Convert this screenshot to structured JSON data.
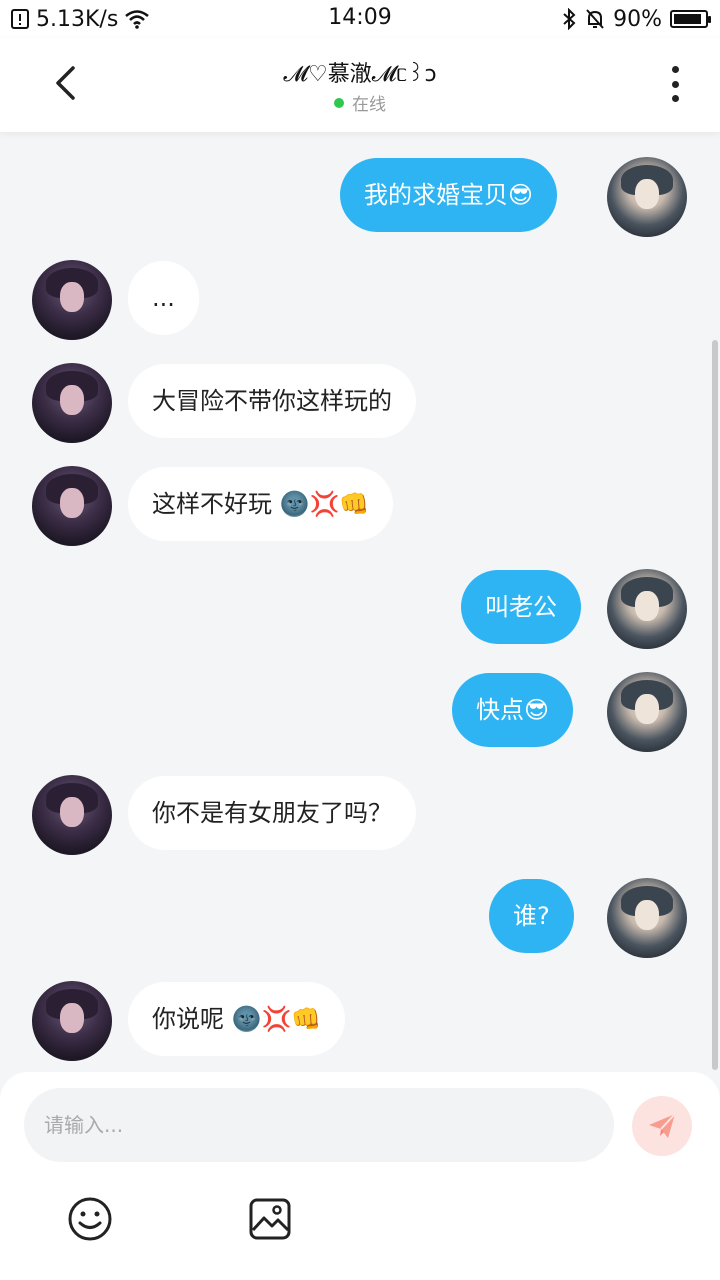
{
  "status_bar": {
    "speed": "5.13K/s",
    "time": "14:09",
    "battery": "90%",
    "battery_level": 0.9
  },
  "header": {
    "title": "𝓜♡慕澈𝓜ᥴ꒱ↄ",
    "status": "在线"
  },
  "messages": [
    {
      "side": "right",
      "text": "我的求婚宝贝😎"
    },
    {
      "side": "left",
      "text": "..."
    },
    {
      "side": "left",
      "text": "大冒险不带你这样玩的"
    },
    {
      "side": "left",
      "text": "这样不好玩 🌚💢👊"
    },
    {
      "side": "right",
      "text": "叫老公"
    },
    {
      "side": "right",
      "text": "快点😎"
    },
    {
      "side": "left",
      "text": "你不是有女朋友了吗？"
    },
    {
      "side": "right",
      "text": "谁?"
    },
    {
      "side": "left",
      "text": "你说呢 🌚💢👊"
    }
  ],
  "input": {
    "placeholder": "请输入..."
  },
  "icons": {
    "back": "back-chevron-icon",
    "more": "more-vertical-icon",
    "send": "send-paper-plane-icon",
    "emoji": "emoji-smile-icon",
    "image": "image-icon"
  },
  "colors": {
    "accent": "#2fb4f3",
    "online": "#2dc84d",
    "send_bg": "#fde3df",
    "send_icon": "#f79c8f"
  }
}
